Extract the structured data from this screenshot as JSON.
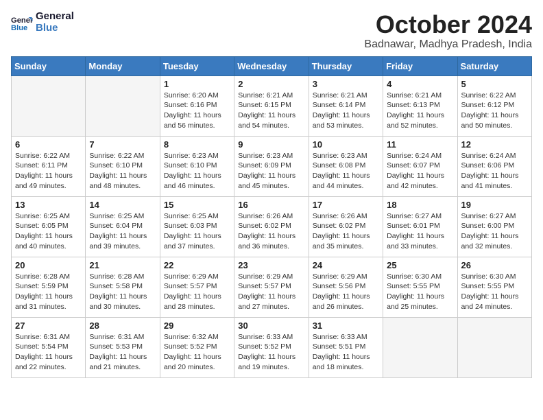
{
  "header": {
    "logo_line1": "General",
    "logo_line2": "Blue",
    "month": "October 2024",
    "location": "Badnawar, Madhya Pradesh, India"
  },
  "weekdays": [
    "Sunday",
    "Monday",
    "Tuesday",
    "Wednesday",
    "Thursday",
    "Friday",
    "Saturday"
  ],
  "weeks": [
    [
      {
        "day": "",
        "info": ""
      },
      {
        "day": "",
        "info": ""
      },
      {
        "day": "1",
        "info": "Sunrise: 6:20 AM\nSunset: 6:16 PM\nDaylight: 11 hours and 56 minutes."
      },
      {
        "day": "2",
        "info": "Sunrise: 6:21 AM\nSunset: 6:15 PM\nDaylight: 11 hours and 54 minutes."
      },
      {
        "day": "3",
        "info": "Sunrise: 6:21 AM\nSunset: 6:14 PM\nDaylight: 11 hours and 53 minutes."
      },
      {
        "day": "4",
        "info": "Sunrise: 6:21 AM\nSunset: 6:13 PM\nDaylight: 11 hours and 52 minutes."
      },
      {
        "day": "5",
        "info": "Sunrise: 6:22 AM\nSunset: 6:12 PM\nDaylight: 11 hours and 50 minutes."
      }
    ],
    [
      {
        "day": "6",
        "info": "Sunrise: 6:22 AM\nSunset: 6:11 PM\nDaylight: 11 hours and 49 minutes."
      },
      {
        "day": "7",
        "info": "Sunrise: 6:22 AM\nSunset: 6:10 PM\nDaylight: 11 hours and 48 minutes."
      },
      {
        "day": "8",
        "info": "Sunrise: 6:23 AM\nSunset: 6:10 PM\nDaylight: 11 hours and 46 minutes."
      },
      {
        "day": "9",
        "info": "Sunrise: 6:23 AM\nSunset: 6:09 PM\nDaylight: 11 hours and 45 minutes."
      },
      {
        "day": "10",
        "info": "Sunrise: 6:23 AM\nSunset: 6:08 PM\nDaylight: 11 hours and 44 minutes."
      },
      {
        "day": "11",
        "info": "Sunrise: 6:24 AM\nSunset: 6:07 PM\nDaylight: 11 hours and 42 minutes."
      },
      {
        "day": "12",
        "info": "Sunrise: 6:24 AM\nSunset: 6:06 PM\nDaylight: 11 hours and 41 minutes."
      }
    ],
    [
      {
        "day": "13",
        "info": "Sunrise: 6:25 AM\nSunset: 6:05 PM\nDaylight: 11 hours and 40 minutes."
      },
      {
        "day": "14",
        "info": "Sunrise: 6:25 AM\nSunset: 6:04 PM\nDaylight: 11 hours and 39 minutes."
      },
      {
        "day": "15",
        "info": "Sunrise: 6:25 AM\nSunset: 6:03 PM\nDaylight: 11 hours and 37 minutes."
      },
      {
        "day": "16",
        "info": "Sunrise: 6:26 AM\nSunset: 6:02 PM\nDaylight: 11 hours and 36 minutes."
      },
      {
        "day": "17",
        "info": "Sunrise: 6:26 AM\nSunset: 6:02 PM\nDaylight: 11 hours and 35 minutes."
      },
      {
        "day": "18",
        "info": "Sunrise: 6:27 AM\nSunset: 6:01 PM\nDaylight: 11 hours and 33 minutes."
      },
      {
        "day": "19",
        "info": "Sunrise: 6:27 AM\nSunset: 6:00 PM\nDaylight: 11 hours and 32 minutes."
      }
    ],
    [
      {
        "day": "20",
        "info": "Sunrise: 6:28 AM\nSunset: 5:59 PM\nDaylight: 11 hours and 31 minutes."
      },
      {
        "day": "21",
        "info": "Sunrise: 6:28 AM\nSunset: 5:58 PM\nDaylight: 11 hours and 30 minutes."
      },
      {
        "day": "22",
        "info": "Sunrise: 6:29 AM\nSunset: 5:57 PM\nDaylight: 11 hours and 28 minutes."
      },
      {
        "day": "23",
        "info": "Sunrise: 6:29 AM\nSunset: 5:57 PM\nDaylight: 11 hours and 27 minutes."
      },
      {
        "day": "24",
        "info": "Sunrise: 6:29 AM\nSunset: 5:56 PM\nDaylight: 11 hours and 26 minutes."
      },
      {
        "day": "25",
        "info": "Sunrise: 6:30 AM\nSunset: 5:55 PM\nDaylight: 11 hours and 25 minutes."
      },
      {
        "day": "26",
        "info": "Sunrise: 6:30 AM\nSunset: 5:55 PM\nDaylight: 11 hours and 24 minutes."
      }
    ],
    [
      {
        "day": "27",
        "info": "Sunrise: 6:31 AM\nSunset: 5:54 PM\nDaylight: 11 hours and 22 minutes."
      },
      {
        "day": "28",
        "info": "Sunrise: 6:31 AM\nSunset: 5:53 PM\nDaylight: 11 hours and 21 minutes."
      },
      {
        "day": "29",
        "info": "Sunrise: 6:32 AM\nSunset: 5:52 PM\nDaylight: 11 hours and 20 minutes."
      },
      {
        "day": "30",
        "info": "Sunrise: 6:33 AM\nSunset: 5:52 PM\nDaylight: 11 hours and 19 minutes."
      },
      {
        "day": "31",
        "info": "Sunrise: 6:33 AM\nSunset: 5:51 PM\nDaylight: 11 hours and 18 minutes."
      },
      {
        "day": "",
        "info": ""
      },
      {
        "day": "",
        "info": ""
      }
    ]
  ]
}
